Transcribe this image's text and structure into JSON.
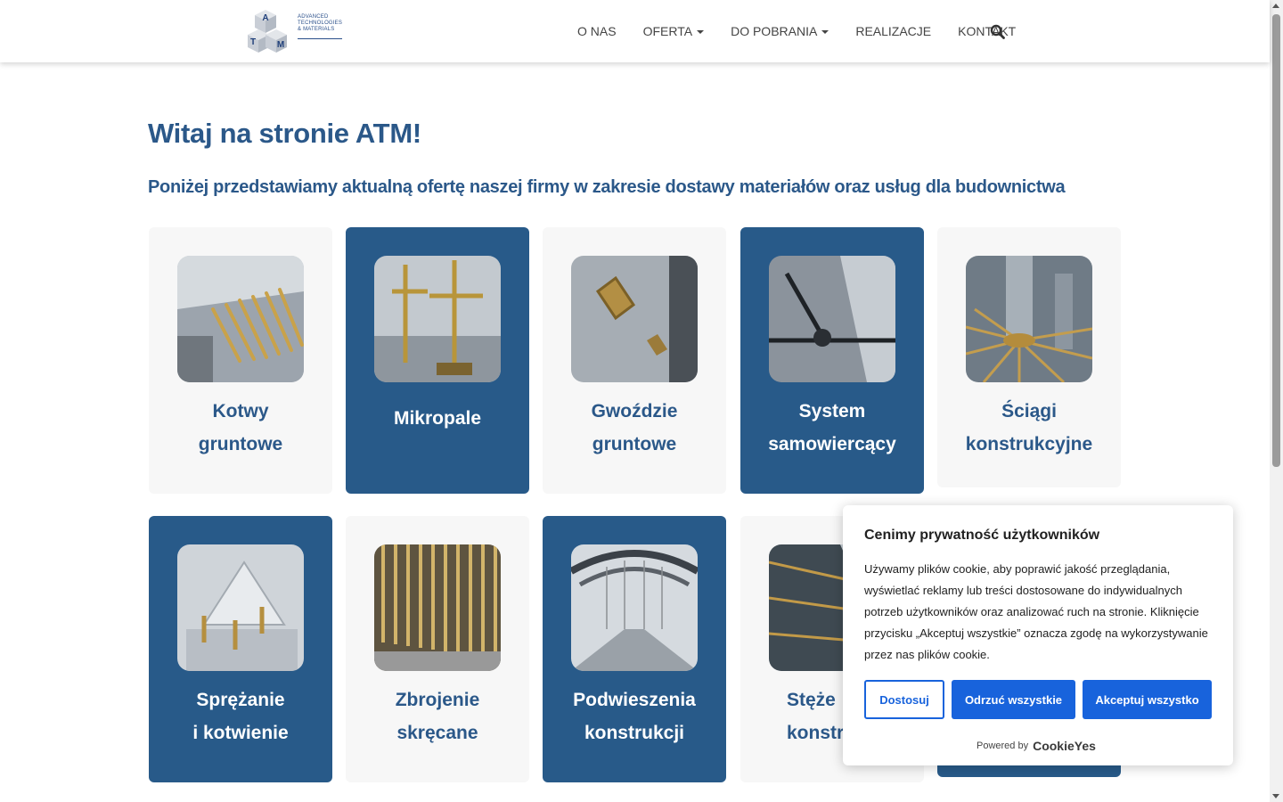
{
  "logo": {
    "letters": [
      "A",
      "T",
      "M"
    ],
    "tagline": [
      "ADVANCED",
      "TECHNOLOGIES",
      "& MATERIALS"
    ]
  },
  "nav": {
    "items": [
      {
        "label": "O NAS",
        "dropdown": false
      },
      {
        "label": "OFERTA",
        "dropdown": true
      },
      {
        "label": "DO POBRANIA",
        "dropdown": true
      },
      {
        "label": "REALIZACJE",
        "dropdown": false
      },
      {
        "label": "KONTAKT",
        "dropdown": false
      }
    ],
    "search_icon": "search-icon"
  },
  "main": {
    "title": "Witaj na stronie ATM!",
    "subtitle": "Poniżej przedstawiamy aktualną ofertę naszej firmy w zakresie dostawy materiałów oraz usług dla budownictwa"
  },
  "cards": [
    {
      "lines": [
        "Kotwy",
        "gruntowe"
      ],
      "theme": "light"
    },
    {
      "lines": [
        "Mikropale"
      ],
      "theme": "dark"
    },
    {
      "lines": [
        "Gwoździe",
        "gruntowe"
      ],
      "theme": "light"
    },
    {
      "lines": [
        "System",
        "samowiercący"
      ],
      "theme": "dark"
    },
    {
      "lines": [
        "Ściągi",
        "konstrukcyjne"
      ],
      "theme": "light"
    },
    {
      "lines": [
        "Sprężanie",
        "i kotwienie"
      ],
      "theme": "dark"
    },
    {
      "lines": [
        "Zbrojenie",
        "skręcane"
      ],
      "theme": "light"
    },
    {
      "lines": [
        "Podwieszenia",
        "konstrukcji"
      ],
      "theme": "dark"
    },
    {
      "lines": [
        "Stęże",
        "konstru"
      ],
      "theme": "light"
    }
  ],
  "cookie": {
    "title": "Cenimy prywatność użytkowników",
    "text": "Używamy plików cookie, aby poprawić jakość przeglądania, wyświetlać reklamy lub treści dostosowane do indywidualnych potrzeb użytkowników oraz analizować ruch na stronie. Kliknięcie przycisku „Akceptuj wszystkie” oznacza zgodę na wykorzystywanie przez nas plików cookie.",
    "customize_label": "Dostosuj",
    "reject_label": "Odrzuć wszystkie",
    "accept_label": "Akceptuj wszystko",
    "powered_by": "Powered by",
    "brand": "CookieYes"
  },
  "colors": {
    "brand": "#285a89",
    "light_card": "#f7f7f7",
    "cookie_button": "#1863dc"
  }
}
